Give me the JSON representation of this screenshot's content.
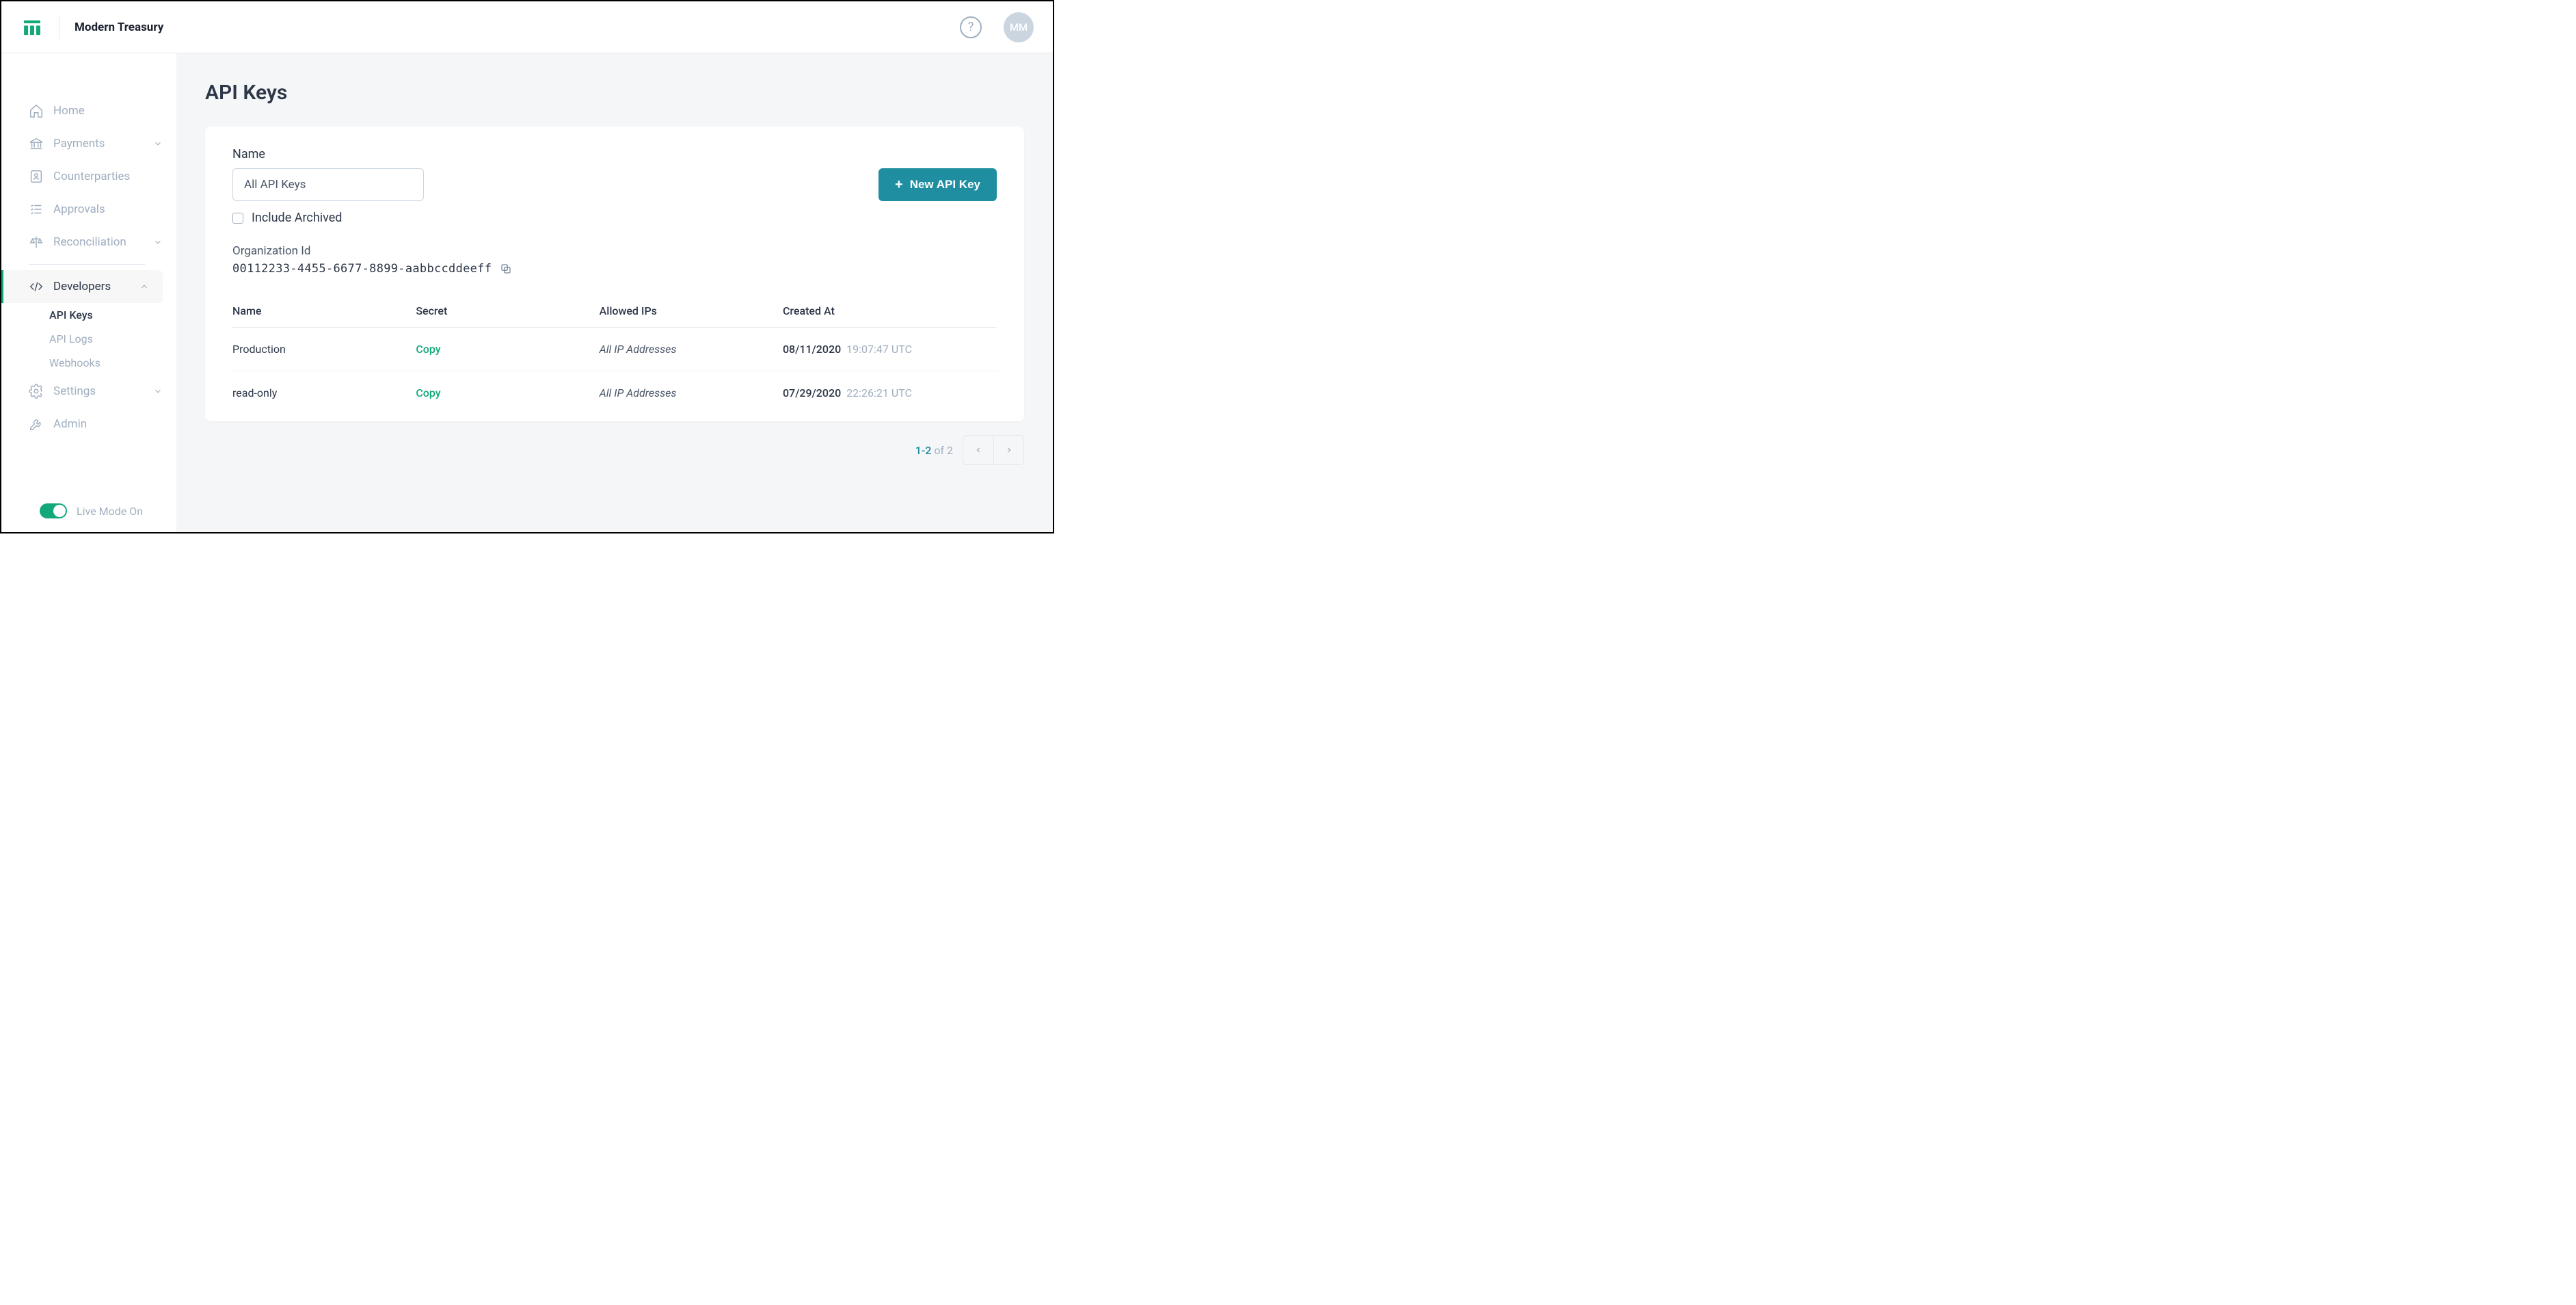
{
  "header": {
    "brand": "Modern Treasury",
    "avatar_initials": "MM"
  },
  "sidebar": {
    "items": [
      {
        "label": "Home"
      },
      {
        "label": "Payments"
      },
      {
        "label": "Counterparties"
      },
      {
        "label": "Approvals"
      },
      {
        "label": "Reconciliation"
      },
      {
        "label": "Developers"
      },
      {
        "label": "Settings"
      },
      {
        "label": "Admin"
      }
    ],
    "developers_sub": [
      {
        "label": "API Keys"
      },
      {
        "label": "API Logs"
      },
      {
        "label": "Webhooks"
      }
    ],
    "live_mode_label": "Live Mode On"
  },
  "main": {
    "page_title": "API Keys",
    "filter_label": "Name",
    "filter_value": "All API Keys",
    "include_archived_label": "Include Archived",
    "new_button_label": "New API Key",
    "org_id_label": "Organization Id",
    "org_id_value": "00112233-4455-6677-8899-aabbccddeeff",
    "columns": {
      "name": "Name",
      "secret": "Secret",
      "allowed_ips": "Allowed IPs",
      "created_at": "Created At"
    },
    "copy_label": "Copy",
    "rows": [
      {
        "name": "Production",
        "allowed_ips": "All IP Addresses",
        "created_date": "08/11/2020",
        "created_time": "19:07:47 UTC"
      },
      {
        "name": "read-only",
        "allowed_ips": "All IP Addresses",
        "created_date": "07/29/2020",
        "created_time": "22:26:21 UTC"
      }
    ],
    "pagination": {
      "range": "1-2",
      "of_label": " of ",
      "total": "2"
    }
  }
}
